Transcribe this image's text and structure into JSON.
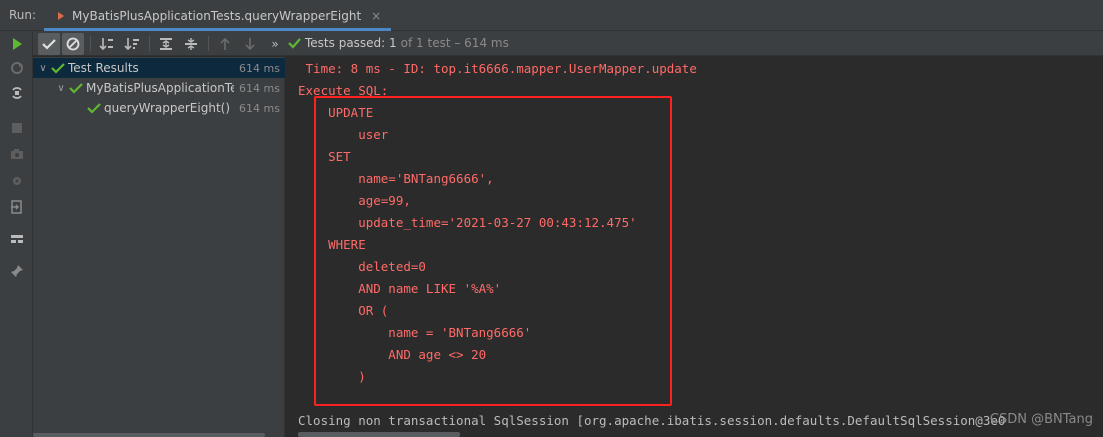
{
  "run_bar": {
    "label": "Run:",
    "tab_title": "MyBatisPlusApplicationTests.queryWrapperEight",
    "tab_close": "×"
  },
  "test_toolbar": {
    "status_main": "Tests passed: 1",
    "status_sub": "of 1 test – 614 ms",
    "more": "»"
  },
  "tree": {
    "rows": [
      {
        "label": "Test Results",
        "time": "614 ms",
        "chev": "∨"
      },
      {
        "label": "MyBatisPlusApplicationTe",
        "time": "614 ms",
        "chev": "∨"
      },
      {
        "label": "queryWrapperEight()",
        "time": "614 ms",
        "chev": ""
      }
    ]
  },
  "console": {
    "lines": [
      " Time: 8 ms - ID: top.it6666.mapper.UserMapper.update",
      "Execute SQL:",
      "    UPDATE",
      "        user",
      "    SET",
      "        name='BNTang6666',",
      "        age=99,",
      "        update_time='2021-03-27 00:43:12.475'",
      "    WHERE",
      "        deleted=0",
      "        AND name LIKE '%A%'",
      "        OR (",
      "            name = 'BNTang6666'",
      "            AND age <> 20",
      "        )"
    ],
    "closing_line": "Closing non transactional SqlSession [org.apache.ibatis.session.defaults.DefaultSqlSession@3e0"
  },
  "watermark": "CSDN @BNTang",
  "colors": {
    "sql_text": "#ff6b68",
    "highlight_box": "#ff2020",
    "pass_green": "#5fb832",
    "tab_underline": "#4a88c7"
  },
  "icons": [
    "run-icon",
    "rerun-icon",
    "toggle-icon",
    "stop-icon",
    "camera-icon",
    "settings-icon",
    "exit-icon",
    "layout-icon",
    "pin-icon",
    "check-icon",
    "cancel-icon",
    "sort-alpha-icon",
    "sort-duration-icon",
    "expand-icon",
    "collapse-icon",
    "up-arrow-icon",
    "down-arrow-icon"
  ]
}
